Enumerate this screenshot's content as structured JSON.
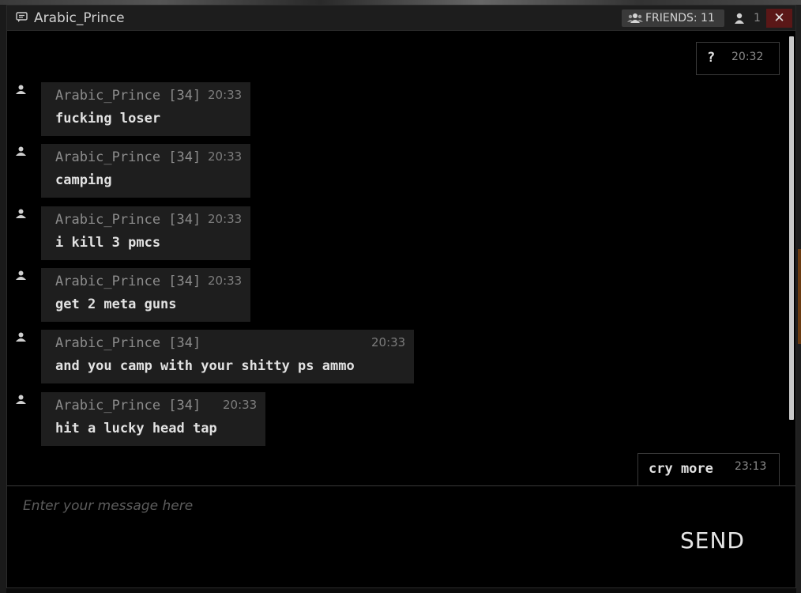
{
  "window": {
    "title": "Arabic_Prince",
    "friends_label": "FRIENDS: 11",
    "online_count": "1",
    "close_label": "✕"
  },
  "icons": {
    "title": "chat-icon",
    "friends": "friends-icon",
    "online": "person-icon",
    "avatar": "person-icon"
  },
  "messages": [
    {
      "type": "outgoing",
      "text": "?",
      "time": "20:32"
    },
    {
      "type": "incoming",
      "sender": "Arabic_Prince [34]",
      "time": "20:33",
      "text": "fucking loser"
    },
    {
      "type": "incoming",
      "sender": "Arabic_Prince [34]",
      "time": "20:33",
      "text": "camping"
    },
    {
      "type": "incoming",
      "sender": "Arabic_Prince [34]",
      "time": "20:33",
      "text": "i kill 3 pmcs"
    },
    {
      "type": "incoming",
      "sender": "Arabic_Prince [34]",
      "time": "20:33",
      "text": "get 2 meta guns"
    },
    {
      "type": "incoming",
      "sender": "Arabic_Prince [34]",
      "time": "20:33",
      "text": "and you camp with your shitty ps ammo"
    },
    {
      "type": "incoming",
      "sender": "Arabic_Prince [34]",
      "time": "20:33",
      "text": "hit a lucky head tap"
    },
    {
      "type": "outgoing",
      "text": "cry more",
      "time": "23:13"
    }
  ],
  "composer": {
    "placeholder": "Enter your message here",
    "send_label": "SEND"
  },
  "colors": {
    "close_bg": "#5a1717",
    "bubble_bg": "#1e1e1e",
    "titlebar_bg": "#1d1d1d"
  }
}
